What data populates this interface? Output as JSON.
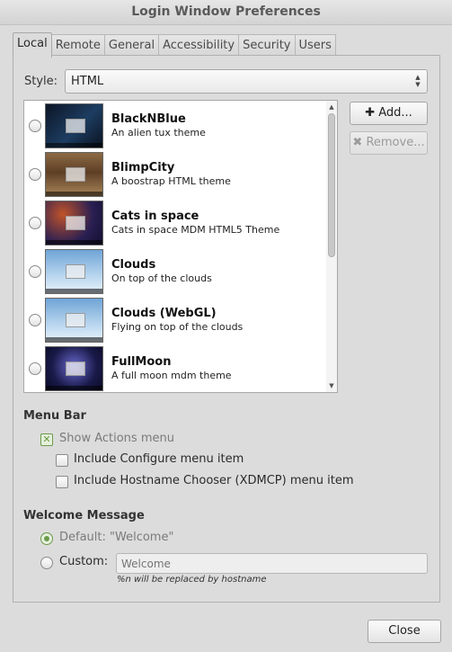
{
  "window": {
    "title": "Login Window Preferences"
  },
  "tabs": [
    {
      "label": "Local",
      "active": true
    },
    {
      "label": "Remote"
    },
    {
      "label": "General"
    },
    {
      "label": "Accessibility"
    },
    {
      "label": "Security"
    },
    {
      "label": "Users"
    }
  ],
  "style": {
    "label": "Style:",
    "value": "HTML"
  },
  "themes": [
    {
      "name": "BlackNBlue",
      "description": "An alien tux theme",
      "colors": [
        "#0c1526",
        "#1d3d61"
      ]
    },
    {
      "name": "BlimpCity",
      "description": "A boostrap HTML theme",
      "colors": [
        "#5d3f26",
        "#a88558"
      ]
    },
    {
      "name": "Cats in space",
      "description": "Cats in space MDM HTML5 Theme",
      "colors": [
        "#2a1f52",
        "#c0532a"
      ]
    },
    {
      "name": "Clouds",
      "description": "On top of the clouds",
      "colors": [
        "#6fa4d6",
        "#e8f2fb"
      ]
    },
    {
      "name": "Clouds (WebGL)",
      "description": "Flying on top of the clouds",
      "colors": [
        "#6fa4d6",
        "#e8f2fb"
      ]
    },
    {
      "name": "FullMoon",
      "description": "A full moon mdm theme",
      "colors": [
        "#1a1a4a",
        "#6a6ad0"
      ]
    }
  ],
  "buttons": {
    "add": "Add...",
    "remove": "Remove...",
    "close": "Close"
  },
  "menu_bar": {
    "heading": "Menu Bar",
    "show_actions": "Show Actions menu",
    "include_configure": "Include Configure menu item",
    "include_hostname": "Include Hostname Chooser (XDMCP) menu item"
  },
  "welcome": {
    "heading": "Welcome Message",
    "default_label": "Default: \"Welcome\"",
    "custom_label": "Custom:",
    "custom_placeholder": "Welcome",
    "hint": "%n will be replaced by hostname"
  },
  "colors": {
    "accent_check": "#6a9a4a",
    "background": "#dcdcdc"
  }
}
